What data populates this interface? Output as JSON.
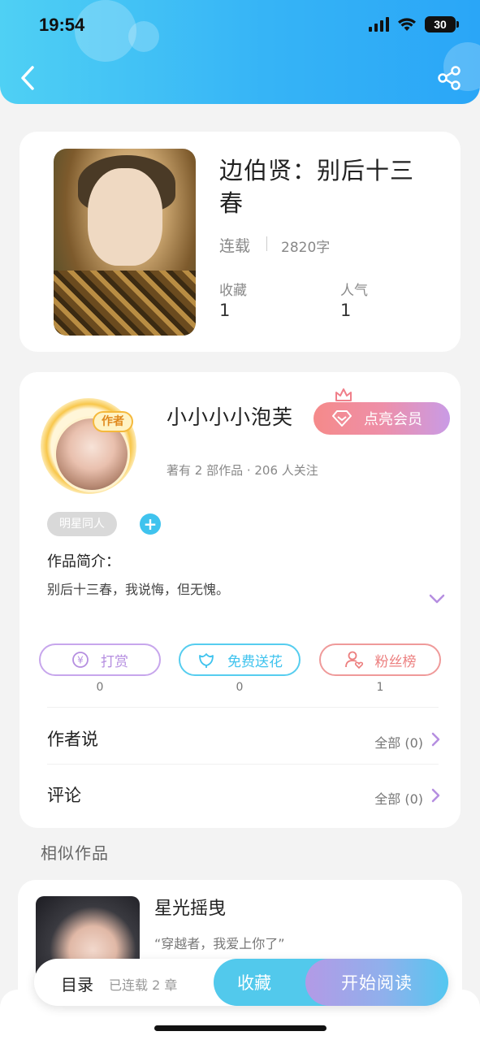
{
  "status_bar": {
    "time": "19:54",
    "battery": "30"
  },
  "book": {
    "title": "边伯贤：别后十三春",
    "status": "连载",
    "word_count": "2820字",
    "collect_label": "收藏",
    "collect_value": "1",
    "popularity_label": "人气",
    "popularity_value": "1"
  },
  "author": {
    "badge": "作者",
    "name": "小小小小泡芙",
    "vip_button": "点亮会员",
    "meta": "著有 2 部作品 · 206 人关注",
    "tag": "明星同人",
    "tag_add": "+",
    "intro_label": "作品简介：",
    "intro_text": "别后十三春，我说悔，但无愧。"
  },
  "actions": [
    {
      "label": "打赏",
      "count": "0"
    },
    {
      "label": "免费送花",
      "count": "0"
    },
    {
      "label": "粉丝榜",
      "count": "1"
    }
  ],
  "rows": {
    "author_say": {
      "label": "作者说",
      "right": "全部 (0)"
    },
    "comments": {
      "label": "评论",
      "right": "全部 (0)"
    }
  },
  "similar": {
    "section_title": "相似作品",
    "item": {
      "title": "星光摇曳",
      "desc": "“穿越者，我爱上你了”"
    }
  },
  "bottom_bar": {
    "toc_label": "目录",
    "toc_count": "已连载 2 章",
    "favorite": "收藏",
    "start_reading": "开始阅读"
  },
  "colors": {
    "accent_blue": "#36b4f6",
    "reward": "#b58ee0",
    "flower": "#3fc3ee",
    "fans": "#ec7f7f"
  }
}
